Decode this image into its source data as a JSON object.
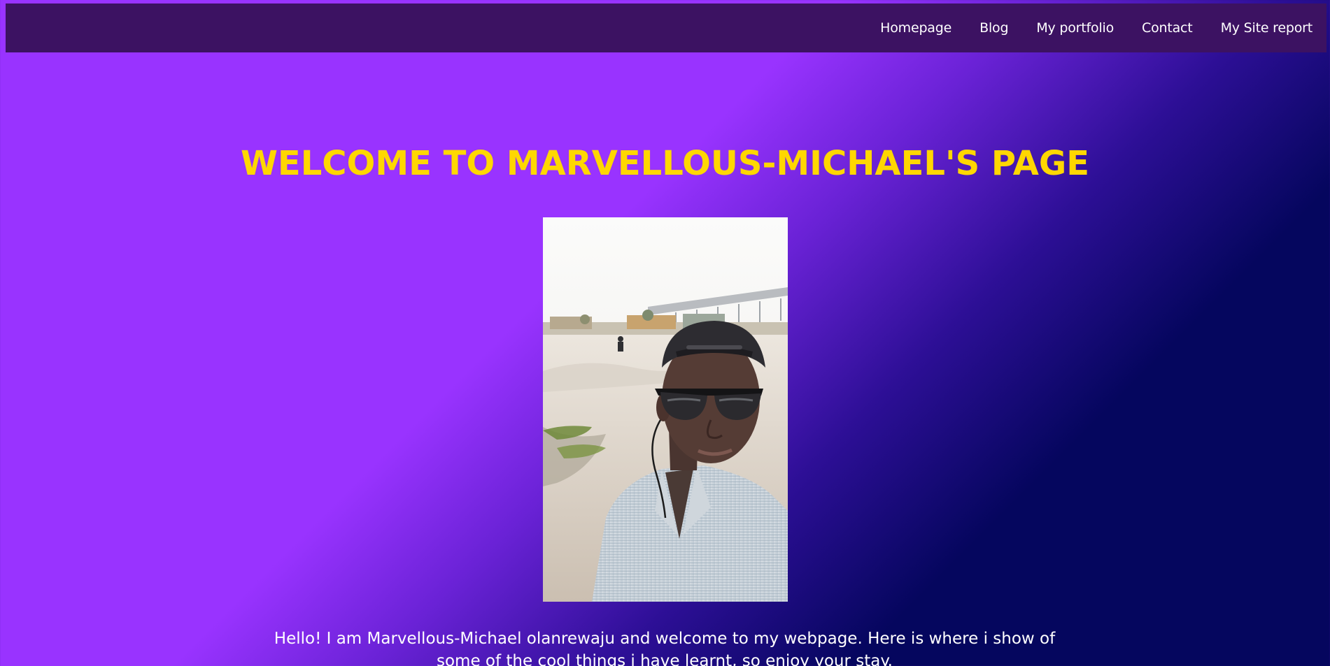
{
  "nav": {
    "items": [
      {
        "label": "Homepage"
      },
      {
        "label": "Blog"
      },
      {
        "label": "My portfolio"
      },
      {
        "label": "Contact"
      },
      {
        "label": "My Site report"
      }
    ]
  },
  "hero": {
    "title": "WELCOME TO MARVELLOUS-MICHAEL'S PAGE"
  },
  "intro": {
    "text": "Hello! I am Marvellous-Michael olanrewaju and welcome to my webpage. Here is where i show of some of the cool things i have learnt, so enjoy your stay."
  },
  "colors": {
    "nav_background": "#3c1262",
    "title": "#ffd700",
    "gradient_start": "#9933ff",
    "gradient_end": "#05065e"
  }
}
